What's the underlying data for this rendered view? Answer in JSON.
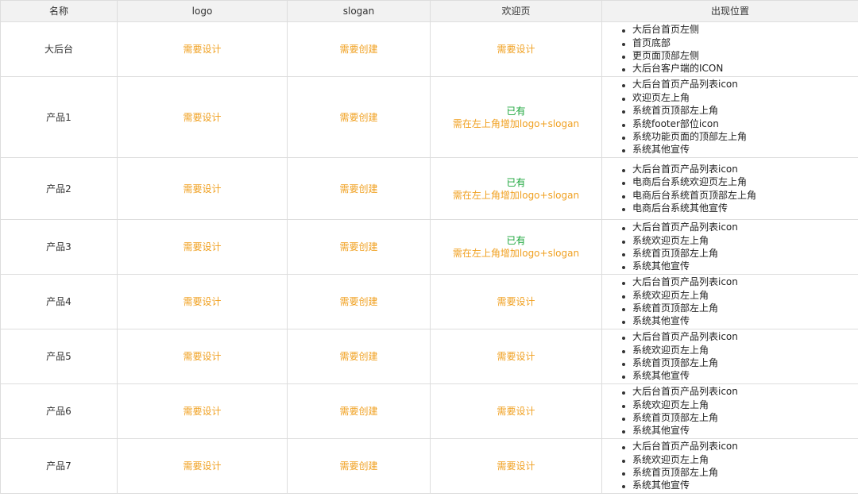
{
  "headers": [
    "名称",
    "logo",
    "slogan",
    "欢迎页",
    "出现位置"
  ],
  "rows": [
    {
      "name": "大后台",
      "logo": "需要设计",
      "slogan": "需要创建",
      "welcome": [
        "需要设计"
      ],
      "locations": [
        "大后台首页左侧",
        "首页底部",
        "更页面顶部左侧",
        "大后台客户端的ICON"
      ]
    },
    {
      "name": "产品1",
      "logo": "需要设计",
      "slogan": "需要创建",
      "welcome": [
        "已有",
        "需在左上角增加logo+slogan"
      ],
      "locations": [
        "大后台首页产品列表icon",
        "欢迎页左上角",
        "系统首页顶部左上角",
        "系统footer部位icon",
        "系统功能页面的顶部左上角",
        "系统其他宣传"
      ]
    },
    {
      "name": "产品2",
      "logo": "需要设计",
      "slogan": "需要创建",
      "welcome": [
        "已有",
        "需在左上角增加logo+slogan"
      ],
      "locations": [
        "大后台首页产品列表icon",
        "电商后台系统欢迎页左上角",
        "电商后台系统首页顶部左上角",
        "电商后台系统其他宣传"
      ]
    },
    {
      "name": "产品3",
      "logo": "需要设计",
      "slogan": "需要创建",
      "welcome": [
        "已有",
        "需在左上角增加logo+slogan"
      ],
      "locations": [
        "大后台首页产品列表icon",
        "系统欢迎页左上角",
        "系统首页顶部左上角",
        "系统其他宣传"
      ]
    },
    {
      "name": "产品4",
      "logo": "需要设计",
      "slogan": "需要创建",
      "welcome": [
        "需要设计"
      ],
      "locations": [
        "大后台首页产品列表icon",
        "系统欢迎页左上角",
        "系统首页顶部左上角",
        "系统其他宣传"
      ]
    },
    {
      "name": "产品5",
      "logo": "需要设计",
      "slogan": "需要创建",
      "welcome": [
        "需要设计"
      ],
      "locations": [
        "大后台首页产品列表icon",
        "系统欢迎页左上角",
        "系统首页顶部左上角",
        "系统其他宣传"
      ]
    },
    {
      "name": "产品6",
      "logo": "需要设计",
      "slogan": "需要创建",
      "welcome": [
        "需要设计"
      ],
      "locations": [
        "大后台首页产品列表icon",
        "系统欢迎页左上角",
        "系统首页顶部左上角",
        "系统其他宣传"
      ]
    },
    {
      "name": "产品7",
      "logo": "需要设计",
      "slogan": "需要创建",
      "welcome": [
        "需要设计"
      ],
      "locations": [
        "大后台首页产品列表icon",
        "系统欢迎页左上角",
        "系统首页顶部左上角",
        "系统其他宣传"
      ]
    }
  ],
  "colors": {
    "header_bg": "#f2f2f2",
    "border": "#dddddd",
    "orange": "#f0a020",
    "green": "#19a53a",
    "text": "#333333"
  }
}
